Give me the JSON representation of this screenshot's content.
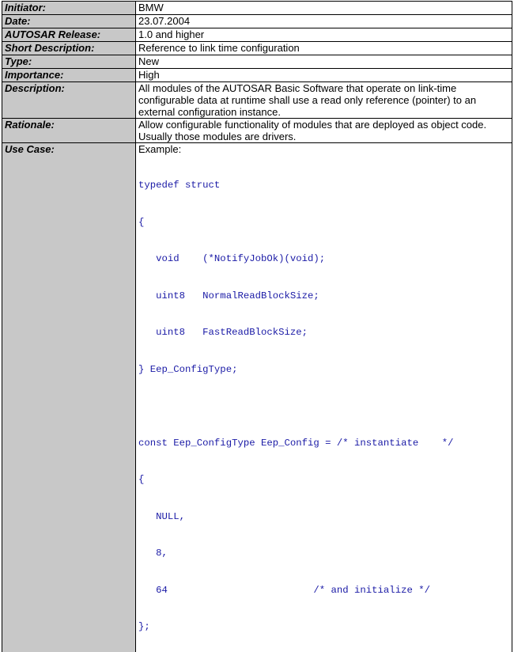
{
  "rows": [
    {
      "label": "Initiator:",
      "value": "BMW"
    },
    {
      "label": "Date:",
      "value": "23.07.2004"
    },
    {
      "label": "AUTOSAR Release:",
      "value": "1.0 and higher"
    },
    {
      "label": "Short Description:",
      "value": "Reference to link time configuration"
    },
    {
      "label": "Type:",
      "value": "New"
    },
    {
      "label": "Importance:",
      "value": "High"
    },
    {
      "label": "Description:",
      "value": "All modules of the AUTOSAR Basic Software that operate on link-time configurable data at runtime shall use a read only reference (pointer) to an external configuration instance."
    },
    {
      "label": "Rationale:",
      "value": "Allow configurable functionality of modules that are deployed as object code. Usually those modules are drivers."
    }
  ],
  "use_case": {
    "label": "Use Case:",
    "example_label": "Example:",
    "code_lines": [
      "typedef struct",
      "{",
      "   void    (*NotifyJobOk)(void);",
      "   uint8   NormalReadBlockSize;",
      "   uint8   FastReadBlockSize;",
      "} Eep_ConfigType;",
      "",
      "const Eep_ConfigType Eep_Config = /* instantiate    */",
      "{",
      "   NULL,",
      "   8,",
      "   64                         /* and initialize */",
      "};"
    ]
  }
}
